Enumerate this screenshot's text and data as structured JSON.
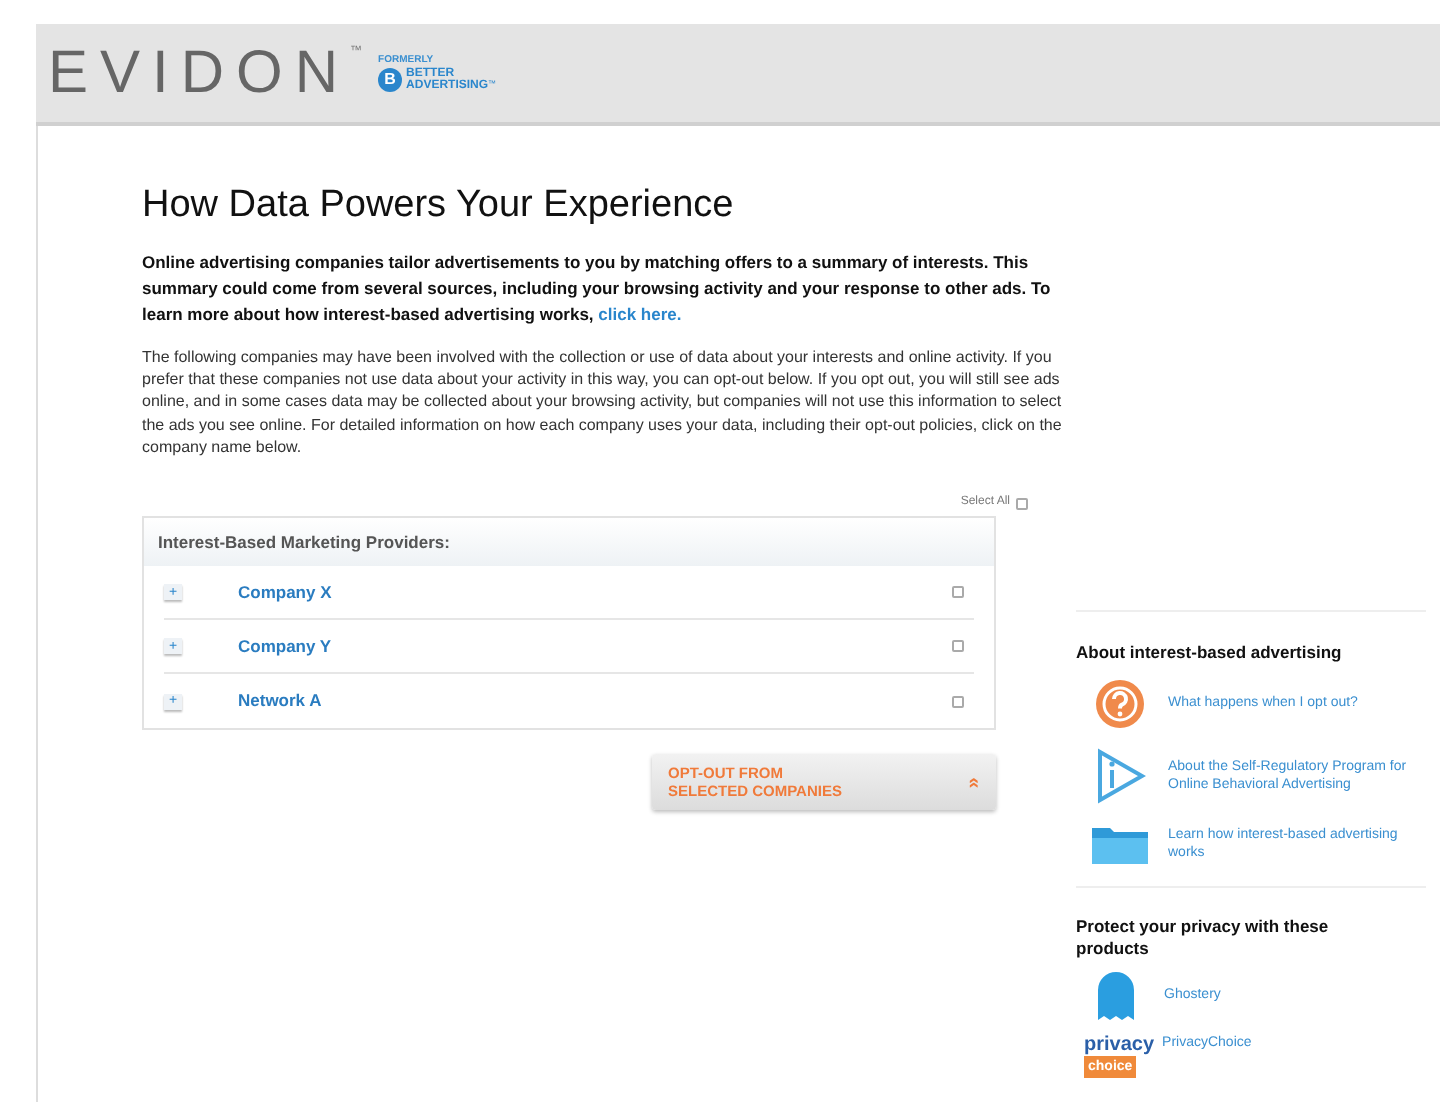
{
  "header": {
    "logo": "EVIDON",
    "logo_mark": "™",
    "formerly": "FORMERLY",
    "badge_letter": "B",
    "brand_line_1": "BETTER",
    "brand_line_2": "ADVERTISING",
    "brand_mark": "™"
  },
  "title": "How Data Powers Your Experience",
  "intro": {
    "text": "Online advertising companies tailor advertisements to you by matching offers to a summary of interests. This summary could come from several sources, including your browsing activity and your response to other ads. To learn more about how interest-based advertising works,",
    "link": "click here."
  },
  "explanation": "The following companies may have been involved with the collection or use of data about your interests and online activity. If you prefer that these companies not use data about your activity in this way, you can opt-out below. If you opt out, you will still see ads online, and in some cases data may be collected about your browsing activity, but companies will not use this information to select the ads you see online. For detailed information on how each company uses your data, including their opt-out policies, click on the company name below.",
  "select_all": {
    "label": "Select All",
    "checked": false
  },
  "providers": {
    "heading": "Interest-Based Marketing Providers:",
    "rows": [
      {
        "expand": "+",
        "name": "Company X",
        "checked": false
      },
      {
        "expand": "+",
        "name": "Company Y",
        "checked": false
      },
      {
        "expand": "+",
        "name": "Network A",
        "checked": false
      }
    ]
  },
  "opt_out_button": {
    "label_1": "OPT-OUT FROM",
    "label_2": "SELECTED COMPANIES",
    "arrow": "»"
  },
  "sidebar": {
    "about_heading": "About interest-based advertising",
    "about_links": [
      {
        "kind": "question",
        "text": "What happens when I opt out?"
      },
      {
        "kind": "play",
        "text": "About the Self-Regulatory Program for Online Behavioral Advertising"
      },
      {
        "kind": "folder",
        "text": "Learn how interest-based advertising works"
      }
    ],
    "protect_heading": "Protect your privacy with these products",
    "products": [
      {
        "kind": "ghost",
        "text": "Ghostery"
      },
      {
        "kind": "privacy",
        "text": "PrivacyChoice",
        "logo_1": "privacy",
        "logo_2": "choice"
      }
    ]
  }
}
